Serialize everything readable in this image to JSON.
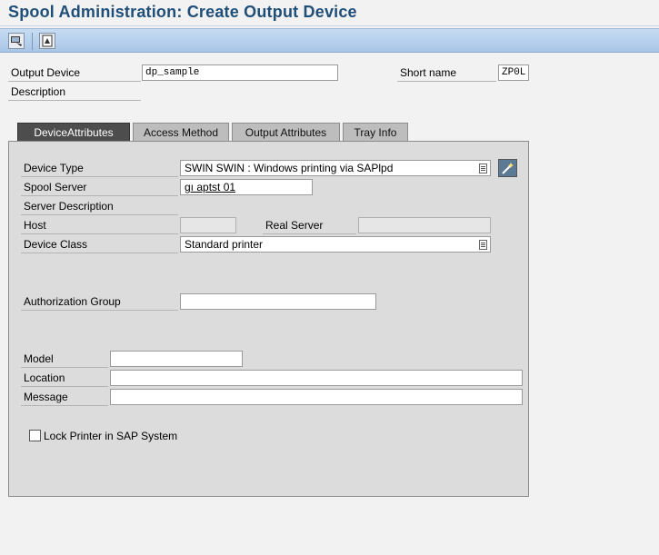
{
  "header": {
    "title": "Spool Administration: Create Output Device"
  },
  "toolbar": {
    "buttons": [
      {
        "icon": "display-change-icon"
      },
      {
        "icon": "document-icon"
      }
    ]
  },
  "top_form": {
    "output_device_label": "Output Device",
    "output_device_value": "dp_sample",
    "short_name_label": "Short name",
    "short_name_value": "ZP0L",
    "description_label": "Description"
  },
  "tabs": [
    {
      "label": "DeviceAttributes",
      "active": true
    },
    {
      "label": "Access Method",
      "active": false
    },
    {
      "label": "Output Attributes",
      "active": false
    },
    {
      "label": "Tray Info",
      "active": false
    }
  ],
  "device_attributes": {
    "device_type_label": "Device Type",
    "device_type_value": "SWIN SWIN     : Windows printing via SAPlpd",
    "spool_server_label": "Spool Server",
    "spool_server_value": "gı  aptst         01",
    "server_description_label": "Server Description",
    "host_label": "Host",
    "host_value": "",
    "real_server_label": "Real Server",
    "real_server_value": "",
    "device_class_label": "Device Class",
    "device_class_value": "Standard printer",
    "authorization_group_label": "Authorization Group",
    "authorization_group_value": "",
    "model_label": "Model",
    "model_value": "",
    "location_label": "Location",
    "location_value": "",
    "message_label": "Message",
    "message_value": "",
    "lock_printer_label": "Lock Printer in SAP System",
    "lock_printer_checked": false
  }
}
